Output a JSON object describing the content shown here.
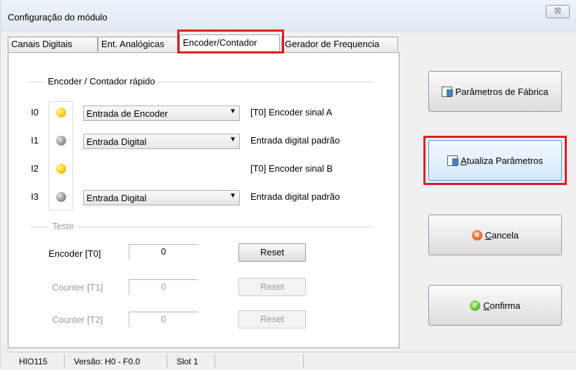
{
  "window": {
    "title": "Configuração do módulo",
    "close_glyph": "☒"
  },
  "tabs": [
    {
      "label": "Canais Digitais",
      "active": false
    },
    {
      "label": "Ent. Analógicas",
      "active": false
    },
    {
      "label": "Encoder/Contador",
      "active": true
    },
    {
      "label": "Gerador de Frequencia",
      "active": false
    }
  ],
  "encoder_group": {
    "title": "Encoder / Contador rápido",
    "channels": [
      {
        "id": "I0",
        "led": "yellow",
        "mode": "Entrada de Encoder",
        "has_combo": true,
        "description": "[T0] Encoder sinal A"
      },
      {
        "id": "I1",
        "led": "gray",
        "mode": "Entrada Digital",
        "has_combo": true,
        "description": "Entrada digital padrão"
      },
      {
        "id": "I2",
        "led": "yellow",
        "mode": "",
        "has_combo": false,
        "description": "[T0] Encoder sinal B"
      },
      {
        "id": "I3",
        "led": "gray",
        "mode": "Entrada Digital",
        "has_combo": true,
        "description": "Entrada digital padrão"
      }
    ],
    "combo_arrow": "▼"
  },
  "test_group": {
    "title": "Teste",
    "rows": [
      {
        "label": "Encoder [T0]",
        "value": "0",
        "reset": "Reset",
        "enabled": true
      },
      {
        "label": "Counter [T1]",
        "value": "0",
        "reset": "Reset",
        "enabled": false
      },
      {
        "label": "Counter [T2]",
        "value": "0",
        "reset": "Reset",
        "enabled": false
      }
    ]
  },
  "side_buttons": {
    "factory": {
      "label": "Parâmetros de Fábrica",
      "icon": "factory-params-icon"
    },
    "update": {
      "accel": "A",
      "rest": "tualiza Parâmetros",
      "icon": "update-params-icon"
    },
    "cancel": {
      "accel": "C",
      "rest": "ancela",
      "icon": "cancel-icon",
      "glyph": "✕"
    },
    "confirm": {
      "accel": "C",
      "rest": "onfirma",
      "icon": "confirm-icon",
      "glyph": "✓"
    }
  },
  "status": {
    "device": "HIO115",
    "version": "Versão: H0 - F0.0",
    "slot": "Slot 1"
  },
  "colors": {
    "highlight": "#e01b24",
    "led_on": "#ffd92b",
    "led_off": "#a4a4a4"
  }
}
